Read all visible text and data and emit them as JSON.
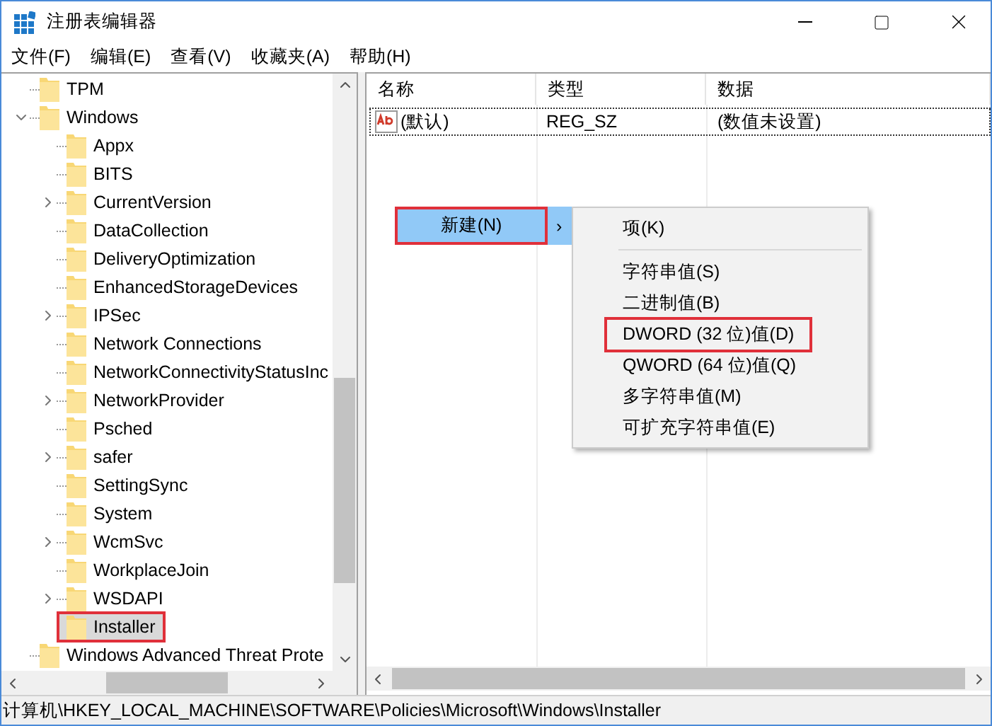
{
  "window": {
    "title": "注册表编辑器"
  },
  "menu_bar": [
    {
      "label": "文件(F)"
    },
    {
      "label": "编辑(E)"
    },
    {
      "label": "查看(V)"
    },
    {
      "label": "收藏夹(A)"
    },
    {
      "label": "帮助(H)"
    }
  ],
  "tree": [
    {
      "label": "TPM",
      "has_children": false,
      "selected": false,
      "annotated": false
    },
    {
      "label": "Windows",
      "has_children": true,
      "expanded": true,
      "selected": false,
      "annotated": false,
      "children": [
        {
          "label": "Appx",
          "has_children": false,
          "selected": false,
          "annotated": false
        },
        {
          "label": "BITS",
          "has_children": false,
          "selected": false,
          "annotated": false
        },
        {
          "label": "CurrentVersion",
          "has_children": true,
          "expanded": false,
          "selected": false,
          "annotated": false
        },
        {
          "label": "DataCollection",
          "has_children": false,
          "selected": false,
          "annotated": false
        },
        {
          "label": "DeliveryOptimization",
          "has_children": false,
          "selected": false,
          "annotated": false
        },
        {
          "label": "EnhancedStorageDevices",
          "has_children": false,
          "selected": false,
          "annotated": false
        },
        {
          "label": "IPSec",
          "has_children": true,
          "expanded": false,
          "selected": false,
          "annotated": false
        },
        {
          "label": "Network Connections",
          "has_children": false,
          "selected": false,
          "annotated": false
        },
        {
          "label": "NetworkConnectivityStatusInc",
          "has_children": false,
          "selected": false,
          "annotated": false
        },
        {
          "label": "NetworkProvider",
          "has_children": true,
          "expanded": false,
          "selected": false,
          "annotated": false
        },
        {
          "label": "Psched",
          "has_children": false,
          "selected": false,
          "annotated": false
        },
        {
          "label": "safer",
          "has_children": true,
          "expanded": false,
          "selected": false,
          "annotated": false
        },
        {
          "label": "SettingSync",
          "has_children": false,
          "selected": false,
          "annotated": false
        },
        {
          "label": "System",
          "has_children": false,
          "selected": false,
          "annotated": false
        },
        {
          "label": "WcmSvc",
          "has_children": true,
          "expanded": false,
          "selected": false,
          "annotated": false
        },
        {
          "label": "WorkplaceJoin",
          "has_children": false,
          "selected": false,
          "annotated": false
        },
        {
          "label": "WSDAPI",
          "has_children": true,
          "expanded": false,
          "selected": false,
          "annotated": false
        },
        {
          "label": "Installer",
          "has_children": false,
          "selected": true,
          "annotated": true
        }
      ]
    },
    {
      "label": "Windows Advanced Threat Prote",
      "has_children": false,
      "selected": false,
      "annotated": false
    }
  ],
  "values_table": {
    "columns": [
      "名称",
      "类型",
      "数据"
    ],
    "rows": [
      {
        "name": "(默认)",
        "type": "REG_SZ",
        "data": "(数值未设置)",
        "selected": true
      }
    ]
  },
  "context_menu": {
    "items": [
      {
        "label": "新建(N)",
        "arrow": "›",
        "highlighted": true,
        "annotated": true
      }
    ]
  },
  "submenu": {
    "items": [
      {
        "kind": "item",
        "label": "项(K)",
        "annotated": false
      },
      {
        "kind": "separator"
      },
      {
        "kind": "item",
        "label": "字符串值(S)",
        "annotated": false
      },
      {
        "kind": "item",
        "label": "二进制值(B)",
        "annotated": false
      },
      {
        "kind": "item",
        "label": "DWORD (32 位)值(D)",
        "annotated": true
      },
      {
        "kind": "item",
        "label": "QWORD (64 位)值(Q)",
        "annotated": false
      },
      {
        "kind": "item",
        "label": "多字符串值(M)",
        "annotated": false
      },
      {
        "kind": "item",
        "label": "可扩充字符串值(E)",
        "annotated": false
      }
    ]
  },
  "status_bar": {
    "path": "计算机\\HKEY_LOCAL_MACHINE\\SOFTWARE\\Policies\\Microsoft\\Windows\\Installer"
  }
}
